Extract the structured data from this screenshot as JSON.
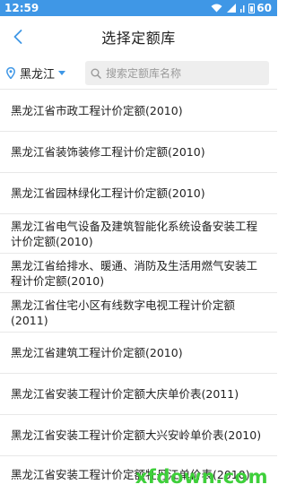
{
  "status_bar": {
    "time": "12:59",
    "battery_level": "60"
  },
  "header": {
    "title": "选择定额库",
    "back_icon": "chevron-left-icon"
  },
  "region": {
    "label": "黑龙江",
    "icon": "location-pin-icon"
  },
  "search": {
    "placeholder": "搜索定额库名称",
    "value": ""
  },
  "items": [
    {
      "label": "黑龙江省市政工程计价定额(2010)"
    },
    {
      "label": "黑龙江省装饰装修工程计价定额(2010)"
    },
    {
      "label": "黑龙江省园林绿化工程计价定额(2010)"
    },
    {
      "label": "黑龙江省电气设备及建筑智能化系统设备安装工程计价定额(2010)"
    },
    {
      "label": "黑龙江省给排水、暖通、消防及生活用燃气安装工程计价定额(2010)"
    },
    {
      "label": "黑龙江省住宅小区有线数字电视工程计价定额(2011)"
    },
    {
      "label": "黑龙江省建筑工程计价定额(2010)"
    },
    {
      "label": "黑龙江省安装工程计价定额大庆单价表(2011)"
    },
    {
      "label": "黑龙江省安装工程计价定额大兴安岭单价表(2010)"
    },
    {
      "label": "黑龙江省安装工程计价定额牡丹江单价表(2010)"
    }
  ],
  "watermark": "xfdown.com",
  "colors": {
    "status_bar": "#3f97e6",
    "accent": "#3f97e6",
    "divider": "#e8e8e8"
  }
}
